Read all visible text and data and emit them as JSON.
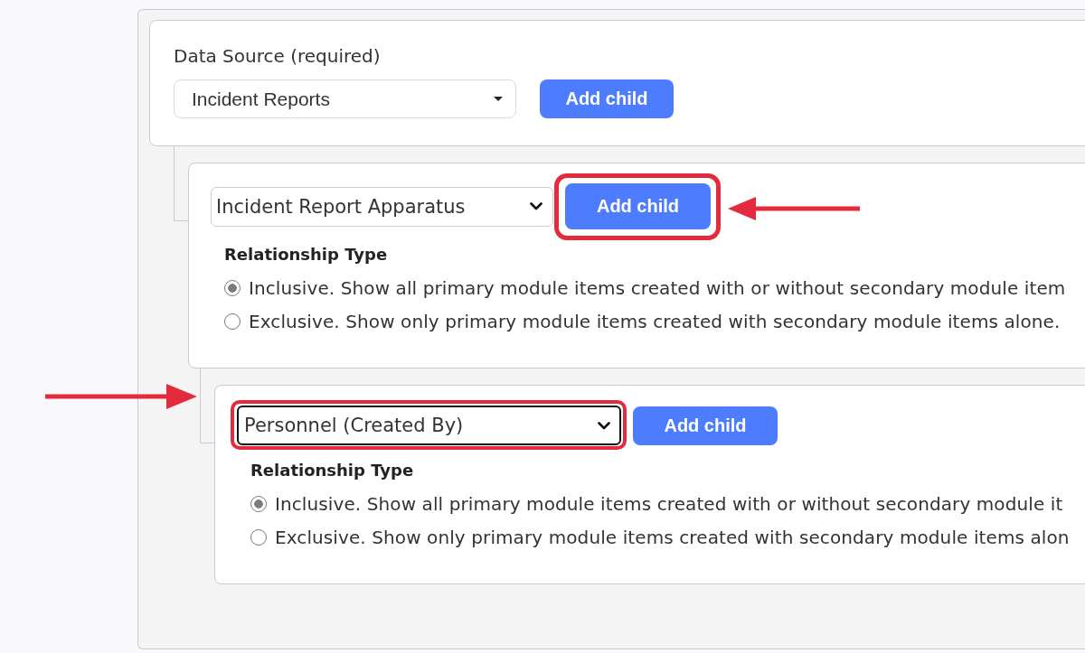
{
  "data_source": {
    "label": "Data Source (required)",
    "select": {
      "kind": "custom",
      "value": "Incident Reports",
      "focused": false,
      "highlighted": false
    },
    "button": {
      "label": "Add child",
      "highlighted": false
    },
    "children": [
      {
        "select": {
          "kind": "native",
          "value": "Incident Report Apparatus",
          "focused": false,
          "highlighted": false
        },
        "button": {
          "label": "Add child",
          "highlighted": true
        },
        "arrow": {
          "kind": "left"
        },
        "relationship": {
          "heading": "Relationship Type",
          "options": [
            {
              "label": "Inclusive. Show all primary module items created with or without secondary module item",
              "selected": true
            },
            {
              "label": "Exclusive. Show only primary module items created with secondary module items alone.",
              "selected": false
            }
          ]
        },
        "children": [
          {
            "select": {
              "kind": "native",
              "value": "Personnel (Created By)",
              "focused": true,
              "highlighted": true
            },
            "button": {
              "label": "Add child",
              "highlighted": false
            },
            "arrow": {
              "kind": "right"
            },
            "relationship": {
              "heading": "Relationship Type",
              "options": [
                {
                  "label": "Inclusive. Show all primary module items created with or without secondary module it",
                  "selected": true
                },
                {
                  "label": "Exclusive. Show only primary module items created with secondary module items alon",
                  "selected": false
                }
              ]
            }
          }
        ]
      }
    ]
  }
}
